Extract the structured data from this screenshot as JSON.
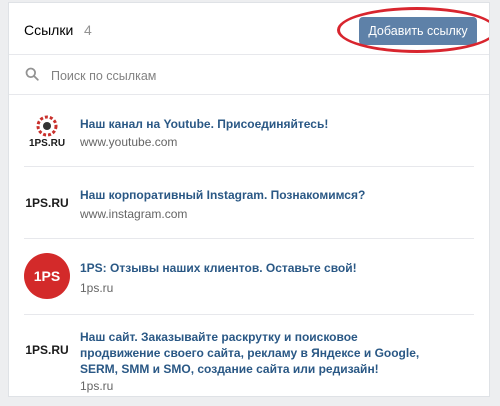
{
  "header": {
    "title": "Ссылки",
    "count": "4",
    "add_button": "Добавить ссылку"
  },
  "search": {
    "placeholder": "Поиск по ссылкам",
    "value": ""
  },
  "links": [
    {
      "thumb_text": "1PS.RU",
      "title": "Наш канал на Youtube. Присоединяйтесь!",
      "url": "www.youtube.com"
    },
    {
      "thumb_text": "1PS.RU",
      "title": "Наш корпоративный Instagram. Познакомимся?",
      "url": "www.instagram.com"
    },
    {
      "thumb_text": "1PS",
      "title": "1PS: Отзывы наших клиентов. Оставьте свой!",
      "url": "1ps.ru"
    },
    {
      "thumb_text": "1PS.RU",
      "title": "Наш сайт. Заказывайте раскрутку и поисковое продвижение своего сайта, рекламу в Яндексе и Google, SERM, SMM и SMO, создание сайта или редизайн!",
      "url": "1ps.ru"
    }
  ],
  "colors": {
    "button": "#5e81a8",
    "link": "#2a5885",
    "highlight": "#d8252e",
    "logo_red": "#d32a2a"
  }
}
